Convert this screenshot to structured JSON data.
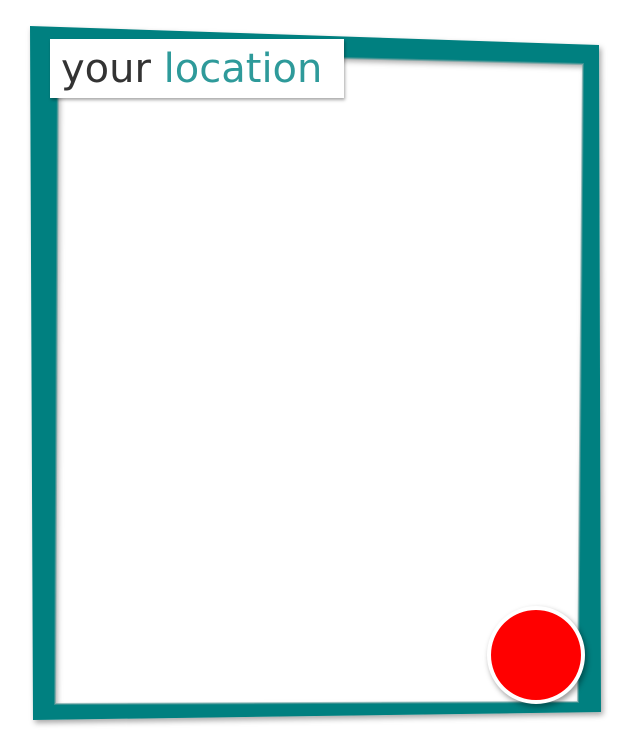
{
  "title": {
    "word_1": "your",
    "word_2": "location"
  },
  "colors": {
    "frame": "#008080",
    "frame_inner_shadow": "#5e9b9b",
    "title_dark": "#333333",
    "title_accent": "#2e9a9a",
    "marker": "#ff0000"
  },
  "marker": {
    "icon": "location-dot-icon"
  }
}
